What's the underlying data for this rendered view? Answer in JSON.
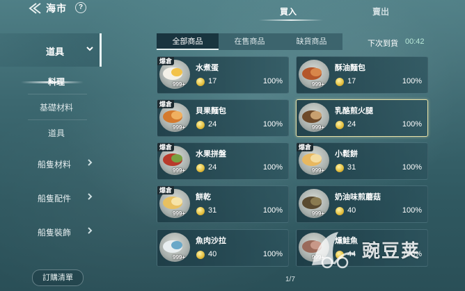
{
  "header": {
    "title": "海市",
    "help": "?",
    "tabs": [
      {
        "label": "買入",
        "active": true
      },
      {
        "label": "賣出",
        "active": false
      }
    ]
  },
  "sidebar": {
    "categories": [
      {
        "label": "道具",
        "expanded": true
      },
      {
        "label": "船隻材料",
        "expanded": false
      },
      {
        "label": "船隻配件",
        "expanded": false
      },
      {
        "label": "船隻裝飾",
        "expanded": false
      }
    ],
    "subcategories": [
      {
        "label": "料理",
        "active": true
      },
      {
        "label": "基礎材料",
        "active": false
      },
      {
        "label": "道具",
        "active": false
      }
    ],
    "order_button": "訂購清單"
  },
  "filters": [
    {
      "label": "全部商品",
      "active": true
    },
    {
      "label": "在售商品",
      "active": false
    },
    {
      "label": "缺貨商品",
      "active": false
    }
  ],
  "restock": {
    "label": "下次到貨",
    "time": "00:42"
  },
  "items": [
    {
      "name": "水煮蛋",
      "badge": "爆倉",
      "qty": "999+",
      "price": "17",
      "percent": "100%",
      "selected": false
    },
    {
      "name": "酥油麵包",
      "badge": "",
      "qty": "999+",
      "price": "17",
      "percent": "100%",
      "selected": false
    },
    {
      "name": "貝果麵包",
      "badge": "爆倉",
      "qty": "999+",
      "price": "24",
      "percent": "100%",
      "selected": false
    },
    {
      "name": "乳酪煎火腿",
      "badge": "",
      "qty": "999+",
      "price": "24",
      "percent": "100%",
      "selected": true
    },
    {
      "name": "水果拼盤",
      "badge": "爆倉",
      "qty": "999+",
      "price": "24",
      "percent": "100%",
      "selected": false
    },
    {
      "name": "小鬆餅",
      "badge": "爆倉",
      "qty": "999+",
      "price": "31",
      "percent": "100%",
      "selected": false
    },
    {
      "name": "餅乾",
      "badge": "爆倉",
      "qty": "999+",
      "price": "31",
      "percent": "100%",
      "selected": false
    },
    {
      "name": "奶油味煎蘑菇",
      "badge": "",
      "qty": "999+",
      "price": "40",
      "percent": "100%",
      "selected": false
    },
    {
      "name": "魚肉沙拉",
      "badge": "",
      "qty": "999+",
      "price": "40",
      "percent": "100%",
      "selected": false
    },
    {
      "name": "燻鮭魚",
      "badge": "",
      "qty": "999+",
      "price": "44",
      "percent": "100%",
      "selected": false
    }
  ],
  "pager": "1/7",
  "watermark": "豌豆荚"
}
